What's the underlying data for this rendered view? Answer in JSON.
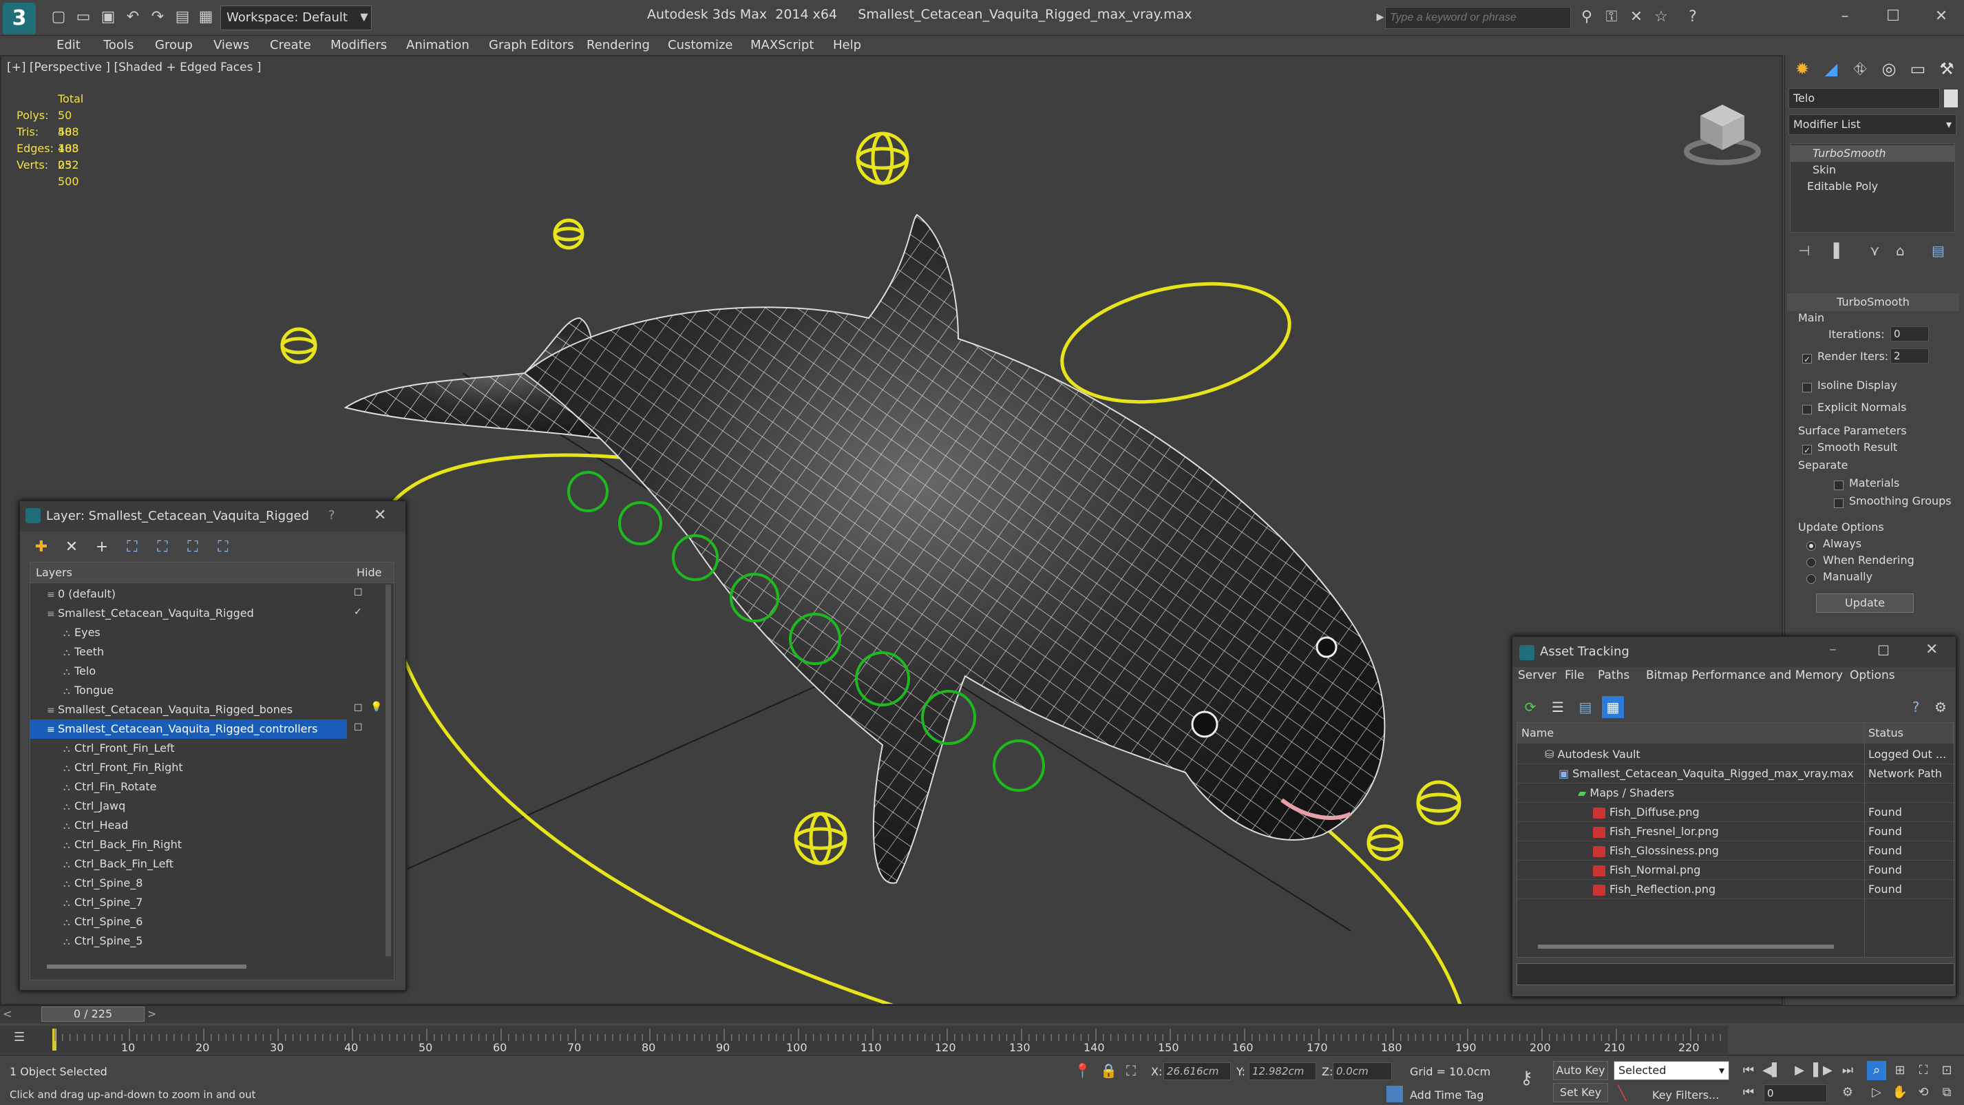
{
  "window": {
    "title": "Autodesk 3ds Max  2014 x64     Smallest_Cetacean_Vaquita_Rigged_max_vray.max",
    "workspace": "Workspace: Default",
    "search_placeholder": "Type a keyword or phrase"
  },
  "menu": [
    "Edit",
    "Tools",
    "Group",
    "Views",
    "Create",
    "Modifiers",
    "Animation",
    "Graph Editors",
    "Rendering",
    "Customize",
    "MAXScript",
    "Help"
  ],
  "viewport": {
    "label": "[+] [Perspective ] [Shaded + Edged Faces ]",
    "stats": {
      "total_label": "Total",
      "rows": [
        {
          "label": "Polys:",
          "value": "50 488"
        },
        {
          "label": "Tris:",
          "value": "50 488"
        },
        {
          "label": "Edges:",
          "value": "103 032"
        },
        {
          "label": "Verts:",
          "value": "25 500"
        }
      ]
    }
  },
  "command_panel": {
    "object_name": "Telo",
    "modifier_list": "Modifier List",
    "stack": [
      "TurboSmooth",
      "Skin",
      "Editable Poly"
    ],
    "rollout_title": "TurboSmooth",
    "main_label": "Main",
    "iterations_label": "Iterations:",
    "iterations_value": "0",
    "render_iters_label": "Render Iters:",
    "render_iters_value": "2",
    "isoline": "Isoline Display",
    "explicit": "Explicit Normals",
    "surface_params": "Surface Parameters",
    "smooth_result": "Smooth Result",
    "separate": "Separate",
    "materials": "Materials",
    "smoothing_groups": "Smoothing Groups",
    "update_options": "Update Options",
    "always": "Always",
    "when_rendering": "When Rendering",
    "manually": "Manually",
    "update_button": "Update"
  },
  "layer_dialog": {
    "title": "Layer: Smallest_Cetacean_Vaquita_Rigged",
    "help": "?",
    "col_layers": "Layers",
    "col_hide": "Hide",
    "rows": [
      {
        "name": "0 (default)",
        "indent": 1
      },
      {
        "name": "Smallest_Cetacean_Vaquita_Rigged",
        "indent": 1
      },
      {
        "name": "Eyes",
        "indent": 2
      },
      {
        "name": "Teeth",
        "indent": 2
      },
      {
        "name": "Telo",
        "indent": 2
      },
      {
        "name": "Tongue",
        "indent": 2
      },
      {
        "name": "Smallest_Cetacean_Vaquita_Rigged_bones",
        "indent": 1
      },
      {
        "name": "Smallest_Cetacean_Vaquita_Rigged_controllers",
        "indent": 1
      },
      {
        "name": "Ctrl_Front_Fin_Left",
        "indent": 2
      },
      {
        "name": "Ctrl_Front_Fin_Right",
        "indent": 2
      },
      {
        "name": "Ctrl_Fin_Rotate",
        "indent": 2
      },
      {
        "name": "Ctrl_Jawq",
        "indent": 2
      },
      {
        "name": "Ctrl_Head",
        "indent": 2
      },
      {
        "name": "Ctrl_Back_Fin_Right",
        "indent": 2
      },
      {
        "name": "Ctrl_Back_Fin_Left",
        "indent": 2
      },
      {
        "name": "Ctrl_Spine_8",
        "indent": 2
      },
      {
        "name": "Ctrl_Spine_7",
        "indent": 2
      },
      {
        "name": "Ctrl_Spine_6",
        "indent": 2
      },
      {
        "name": "Ctrl_Spine_5",
        "indent": 2
      }
    ]
  },
  "asset_dialog": {
    "title": "Asset Tracking",
    "menu": [
      "Server",
      "File",
      "Paths",
      "Bitmap Performance and Memory",
      "Options"
    ],
    "col_name": "Name",
    "col_status": "Status",
    "rows": [
      {
        "name": "Autodesk Vault",
        "status": "Logged Out ...",
        "indent": 1
      },
      {
        "name": "Smallest_Cetacean_Vaquita_Rigged_max_vray.max",
        "status": "Network Path",
        "indent": 2
      },
      {
        "name": "Maps / Shaders",
        "status": "",
        "indent": 3
      },
      {
        "name": "Fish_Diffuse.png",
        "status": "Found",
        "indent": 4
      },
      {
        "name": "Fish_Fresnel_lor.png",
        "status": "Found",
        "indent": 4
      },
      {
        "name": "Fish_Glossiness.png",
        "status": "Found",
        "indent": 4
      },
      {
        "name": "Fish_Normal.png",
        "status": "Found",
        "indent": 4
      },
      {
        "name": "Fish_Reflection.png",
        "status": "Found",
        "indent": 4
      }
    ]
  },
  "timeline": {
    "frame": "0 / 225",
    "ticks": [
      "10",
      "20",
      "30",
      "40",
      "50",
      "60",
      "70",
      "80",
      "90",
      "100",
      "110",
      "120",
      "130",
      "140",
      "150",
      "160",
      "170",
      "180",
      "190",
      "200",
      "210",
      "220"
    ]
  },
  "status": {
    "selected": "1 Object Selected",
    "hint": "Click and drag up-and-down to zoom in and out",
    "x_label": "X:",
    "x_value": "26.616cm",
    "y_label": "Y:",
    "y_value": "12.982cm",
    "z_label": "Z:",
    "z_value": "0.0cm",
    "grid": "Grid = 10.0cm",
    "add_time_tag": "Add Time Tag",
    "auto_key": "Auto Key",
    "set_key": "Set Key",
    "selected_dropdown": "Selected",
    "key_filters": "Key Filters...",
    "frame_field": "0"
  }
}
